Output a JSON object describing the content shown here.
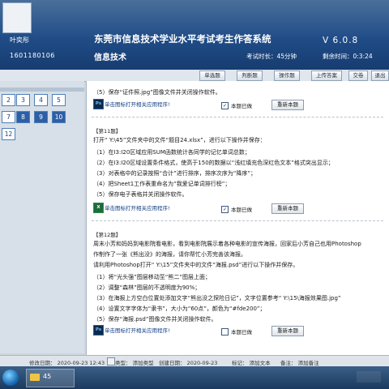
{
  "header": {
    "student_name": "叶奕彤",
    "student_id": "1601180106",
    "system_title": "东莞市信息技术学业水平考试考生作答系统",
    "subject": "信息技术",
    "version": "V 6.0.8",
    "exam_time": "考试时长：45分钟",
    "remaining": "剩余时间：0:3:24"
  },
  "toolbar": {
    "buttons": [
      "单选题",
      "判断题",
      "操作题",
      "上传答案",
      "交卷",
      "退出"
    ]
  },
  "question_nav": {
    "rows": [
      [
        {
          "label": "2",
          "status": "todo"
        },
        {
          "label": "3",
          "status": "todo"
        },
        {
          "label": "4",
          "status": "todo"
        },
        {
          "label": "5",
          "status": "todo"
        }
      ],
      [
        {
          "label": "7",
          "status": "todo"
        },
        {
          "label": "8",
          "status": "done"
        },
        {
          "label": "9",
          "status": "done"
        },
        {
          "label": "10",
          "status": "done"
        }
      ],
      [
        {
          "label": "12",
          "status": "todo"
        }
      ]
    ]
  },
  "questions": {
    "prev_tail": "（5）保存“证件照.jpg”图像文件并关闭操作软件。",
    "q11": {
      "title": "【第11题】",
      "intro": "打开“ Y:\\45”文件夹中的文件“题目24.xlsx”，进行以下操作并保存：",
      "steps": [
        "（1）在I3:I20区域应用SUM函数统计各同学的记忆单词总数；",
        "（2）在I3:I20区域设置条件格式，使高于150的数据以“浅红填充色深红色文本”格式突出显示；",
        "（3）对表格中的记录按照“合计”进行排序，排序次序为“降序”；",
        "（4）把Sheet1工作表重命名为“我爱记单词排行榜”；",
        "（5）保存电子表格并关闭操作软件。"
      ]
    },
    "q12": {
      "title": "【第12题】",
      "intro_lines": [
        "周末小芳和妈妈到电影院看电影，看到电影院展示着各种电影的宣传海报，回家后小芳自己也用Photoshop",
        "作制作了一张《熊出没》的海报，请你帮忙小芳完善该海报。",
        "请利用Photoshop打开“ Y:\\15”文件夹中的文件“海报.psd”进行以下操作并保存。"
      ],
      "steps": [
        "（1）将“光头强”图层移动至“熊二”图层上面；",
        "（2）调整“森林”图层的不透明度为90%；",
        "（3）在海报上方空白位置处添加文字“熊出没之探险日记”，文字位置参考“ Y:\\15\\海报效果图.jpg”",
        "（4）设置文字字体为“隶书”，大小为“60点”，颜色为“#fde200”；",
        "（5）保存“海报.psd”图像文件并关闭操作软件。"
      ]
    },
    "open_app_label": "单击图标打开相关应用程序!",
    "ps_icon_text": "Ps",
    "excel_icon_text": "X",
    "mark_label": "本题已做",
    "redo_label": "重新本题",
    "checkmark": "✓"
  },
  "statusbar": {
    "modified_time": "修改日期： 2020-09-23 12:43",
    "type": "类型： 添加类型",
    "created_time": "创建日期： 2020-09-23",
    "tag": "标记： 添加文本",
    "note": "备注： 添加备注",
    "size": "大小： 2020-09-23 12:43"
  },
  "taskbar": {
    "folder_label": "45"
  }
}
